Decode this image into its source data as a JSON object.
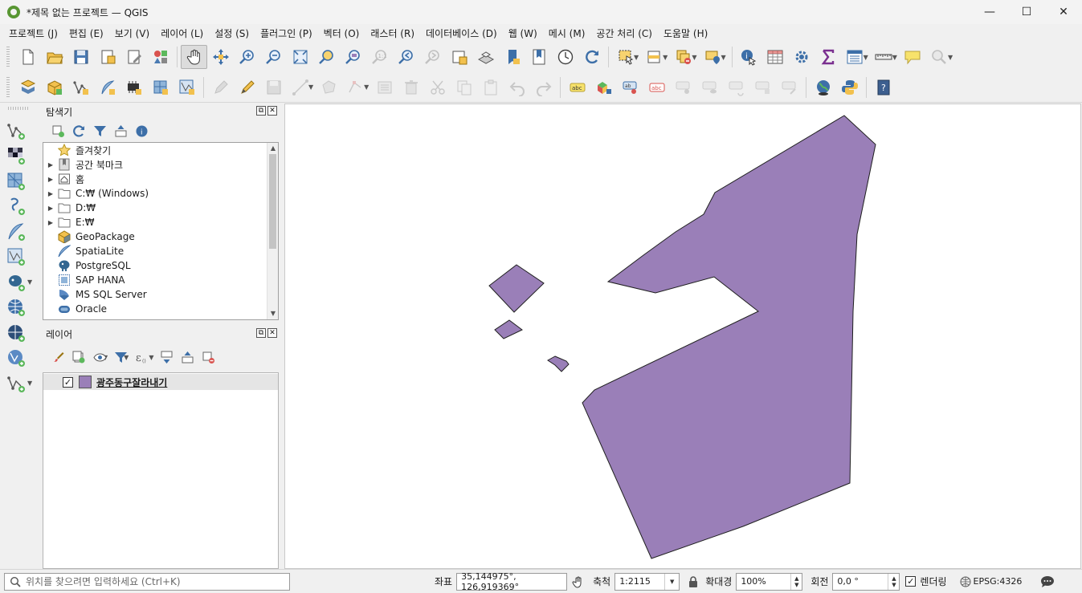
{
  "window": {
    "title": "*제목 없는 프로젝트 — QGIS",
    "controls": {
      "minimize": "—",
      "maximize": "☐",
      "close": "✕"
    }
  },
  "menu": [
    "프로젝트 (J)",
    "편집 (E)",
    "보기 (V)",
    "레이어 (L)",
    "설정 (S)",
    "플러그인 (P)",
    "벡터 (O)",
    "래스터 (R)",
    "데이터베이스 (D)",
    "웹 (W)",
    "메시 (M)",
    "공간 처리 (C)",
    "도움말 (H)"
  ],
  "browser": {
    "title": "탐색기",
    "items": [
      {
        "label": "즐겨찾기",
        "icon": "star-icon",
        "expandable": false
      },
      {
        "label": "공간 북마크",
        "icon": "bookmark-icon",
        "expandable": true
      },
      {
        "label": "홈",
        "icon": "home-icon",
        "expandable": true
      },
      {
        "label": "C:₩ (Windows)",
        "icon": "folder-icon",
        "expandable": true
      },
      {
        "label": "D:₩",
        "icon": "folder-icon",
        "expandable": true
      },
      {
        "label": "E:₩",
        "icon": "folder-icon",
        "expandable": true
      },
      {
        "label": "GeoPackage",
        "icon": "geopackage-icon",
        "expandable": false
      },
      {
        "label": "SpatiaLite",
        "icon": "spatialite-icon",
        "expandable": false
      },
      {
        "label": "PostgreSQL",
        "icon": "postgresql-icon",
        "expandable": false
      },
      {
        "label": "SAP HANA",
        "icon": "sap-hana-icon",
        "expandable": false
      },
      {
        "label": "MS SQL Server",
        "icon": "mssql-icon",
        "expandable": false
      },
      {
        "label": "Oracle",
        "icon": "oracle-icon",
        "expandable": false
      }
    ]
  },
  "layers": {
    "title": "레이어",
    "items": [
      {
        "name": "광주동구잘라내기",
        "checked": true,
        "swatch": "#9a7fb8"
      }
    ]
  },
  "map": {
    "fill": "#9a7fb8",
    "stroke": "#1f1f1f"
  },
  "status": {
    "locator_placeholder": "위치를 찾으려면 입력하세요 (Ctrl+K)",
    "coord_label": "좌표",
    "coord_value": "35,144975°, 126,919369°",
    "scale_label": "축척",
    "scale_value": "1:2115",
    "magnifier_label": "확대경",
    "magnifier_value": "100%",
    "rotation_label": "회전",
    "rotation_value": "0,0 °",
    "render_label": "렌더링",
    "render_checked": true,
    "crs": "EPSG:4326"
  }
}
